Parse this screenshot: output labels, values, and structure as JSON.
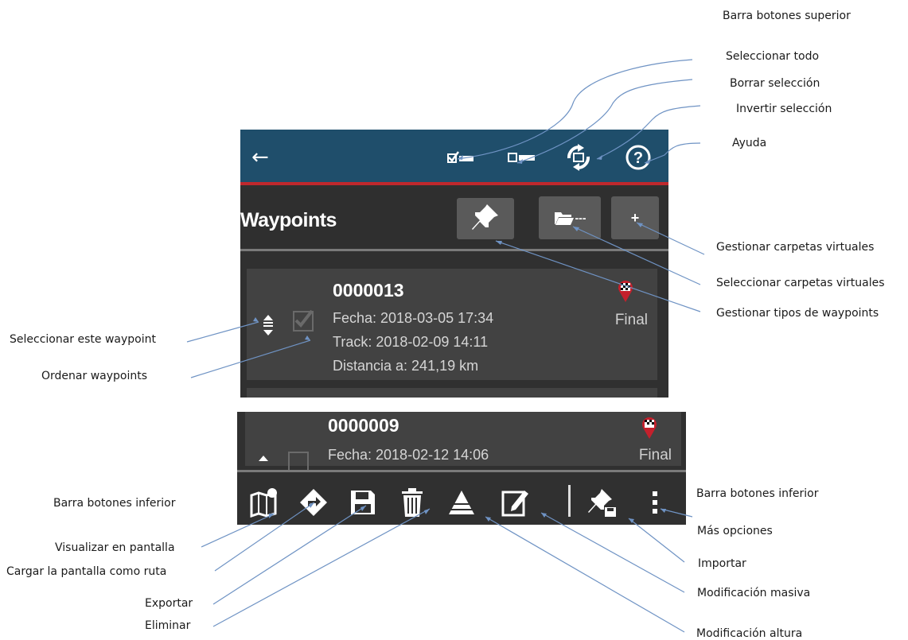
{
  "annotations": {
    "top_bar": "Barra botones superior",
    "select_all": "Seleccionar todo",
    "clear_selection": "Borrar selección",
    "invert_selection": "Invertir selección",
    "help": "Ayuda",
    "manage_virtual_folders": "Gestionar carpetas virtuales",
    "select_virtual_folders": "Seleccionar carpetas virtuales",
    "manage_waypoint_types": "Gestionar tipos de waypoints",
    "select_this_waypoint": "Seleccionar este waypoint",
    "sort_waypoints": "Ordenar waypoints",
    "bottom_bar_left": "Barra botones inferior",
    "bottom_bar_right": "Barra botones inferior",
    "more_options": "Más opciones",
    "show_on_screen": "Visualizar en pantalla",
    "load_screen_as_route": "Cargar la pantalla como ruta",
    "import": "Importar",
    "mass_edit": "Modificación masiva",
    "export": "Exportar",
    "delete": "Eliminar",
    "height_edit": "Modificación altura"
  },
  "app": {
    "title": "Waypoints",
    "folder_btn_label": "---",
    "add_btn_label": "+",
    "colors": {
      "topbar": "#1f4e6b",
      "accent_line": "#c0282d",
      "background": "#303030",
      "card": "#424242"
    },
    "icons": [
      "back-arrow-icon",
      "select-all-icon",
      "clear-selection-icon",
      "invert-selection-icon",
      "help-icon",
      "pushpin-icon",
      "folder-icon",
      "add-icon"
    ]
  },
  "waypoints": [
    {
      "name": "0000013",
      "date": "Fecha: 2018-03-05 17:34",
      "track": "Track: 2018-02-09 14:11",
      "distance": "Distancia a: 241,19 km",
      "type": "Final"
    },
    {
      "name": "0000009",
      "date": "Fecha: 2018-02-12 14:06",
      "type": "Final"
    }
  ],
  "bottom_icons": [
    "map-icon",
    "route-icon",
    "save-icon",
    "trash-icon",
    "altitude-icon",
    "edit-icon",
    "import-icon",
    "more-icon"
  ]
}
